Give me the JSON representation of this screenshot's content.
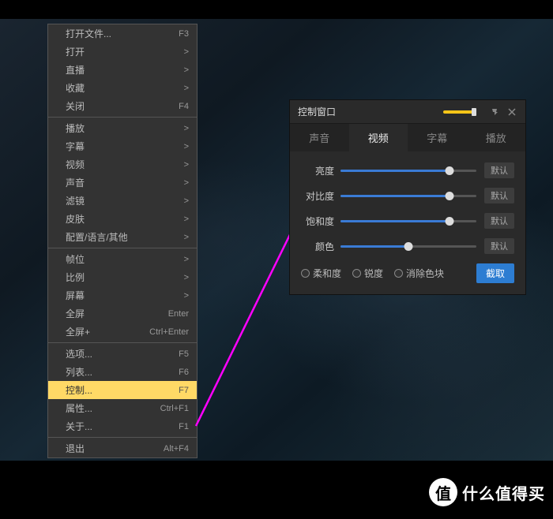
{
  "menu": {
    "groups": [
      [
        {
          "label": "打开文件...",
          "shortcut": "F3"
        },
        {
          "label": "打开",
          "sub": ">"
        },
        {
          "label": "直播",
          "sub": ">"
        },
        {
          "label": "收藏",
          "sub": ">"
        },
        {
          "label": "关闭",
          "shortcut": "F4"
        }
      ],
      [
        {
          "label": "播放",
          "sub": ">"
        },
        {
          "label": "字幕",
          "sub": ">"
        },
        {
          "label": "视频",
          "sub": ">"
        },
        {
          "label": "声音",
          "sub": ">"
        },
        {
          "label": "滤镜",
          "sub": ">"
        },
        {
          "label": "皮肤",
          "sub": ">"
        },
        {
          "label": "配置/语言/其他",
          "sub": ">"
        }
      ],
      [
        {
          "label": "帧位",
          "sub": ">"
        },
        {
          "label": "比例",
          "sub": ">"
        },
        {
          "label": "屏幕",
          "sub": ">"
        },
        {
          "label": "全屏",
          "shortcut": "Enter"
        },
        {
          "label": "全屏+",
          "shortcut": "Ctrl+Enter"
        }
      ],
      [
        {
          "label": "选项...",
          "shortcut": "F5"
        },
        {
          "label": "列表...",
          "shortcut": "F6"
        },
        {
          "label": "控制...",
          "shortcut": "F7",
          "highlighted": true
        },
        {
          "label": "属性...",
          "shortcut": "Ctrl+F1"
        },
        {
          "label": "关于...",
          "shortcut": "F1"
        }
      ],
      [
        {
          "label": "退出",
          "shortcut": "Alt+F4"
        }
      ]
    ]
  },
  "control_window": {
    "title": "控制窗口",
    "tabs": [
      "声音",
      "视频",
      "字幕",
      "播放"
    ],
    "active_tab": 1,
    "sliders": [
      {
        "label": "亮度",
        "value": 80,
        "reset": "默认"
      },
      {
        "label": "对比度",
        "value": 80,
        "reset": "默认"
      },
      {
        "label": "饱和度",
        "value": 80,
        "reset": "默认"
      },
      {
        "label": "颜色",
        "value": 50,
        "reset": "默认"
      }
    ],
    "radios": [
      "柔和度",
      "锐度",
      "消除色块"
    ],
    "capture": "截取"
  },
  "watermark": {
    "badge": "值",
    "text": "什么值得买"
  }
}
